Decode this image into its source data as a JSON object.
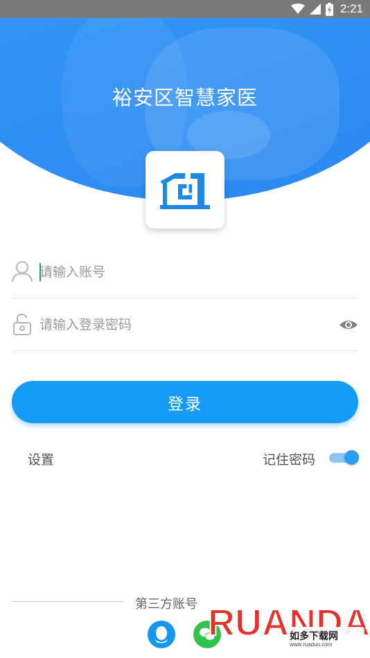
{
  "status_bar": {
    "time": "2:21",
    "icons": [
      "wifi-icon",
      "signal-icon",
      "battery-icon"
    ]
  },
  "header": {
    "title": "裕安区智慧家医"
  },
  "logo": {
    "icon": "home-building-logo"
  },
  "login_form": {
    "account_placeholder": "请输入账号",
    "password_placeholder": "请输入登录密码",
    "login_button": "登录"
  },
  "options": {
    "settings_label": "设置",
    "remember_password_label": "记住密码",
    "remember_password_enabled": true
  },
  "third_party": {
    "label": "第三方账号",
    "providers": [
      "qq-icon",
      "wechat-icon"
    ]
  },
  "watermark": {
    "brand": "RUANDAO",
    "subtitle": "如多下载网",
    "url": "www.ruaduo.com"
  },
  "colors": {
    "primary": "#159bf6",
    "header_blue": "#2a87f0",
    "status_bar": "#7a7a7a"
  }
}
